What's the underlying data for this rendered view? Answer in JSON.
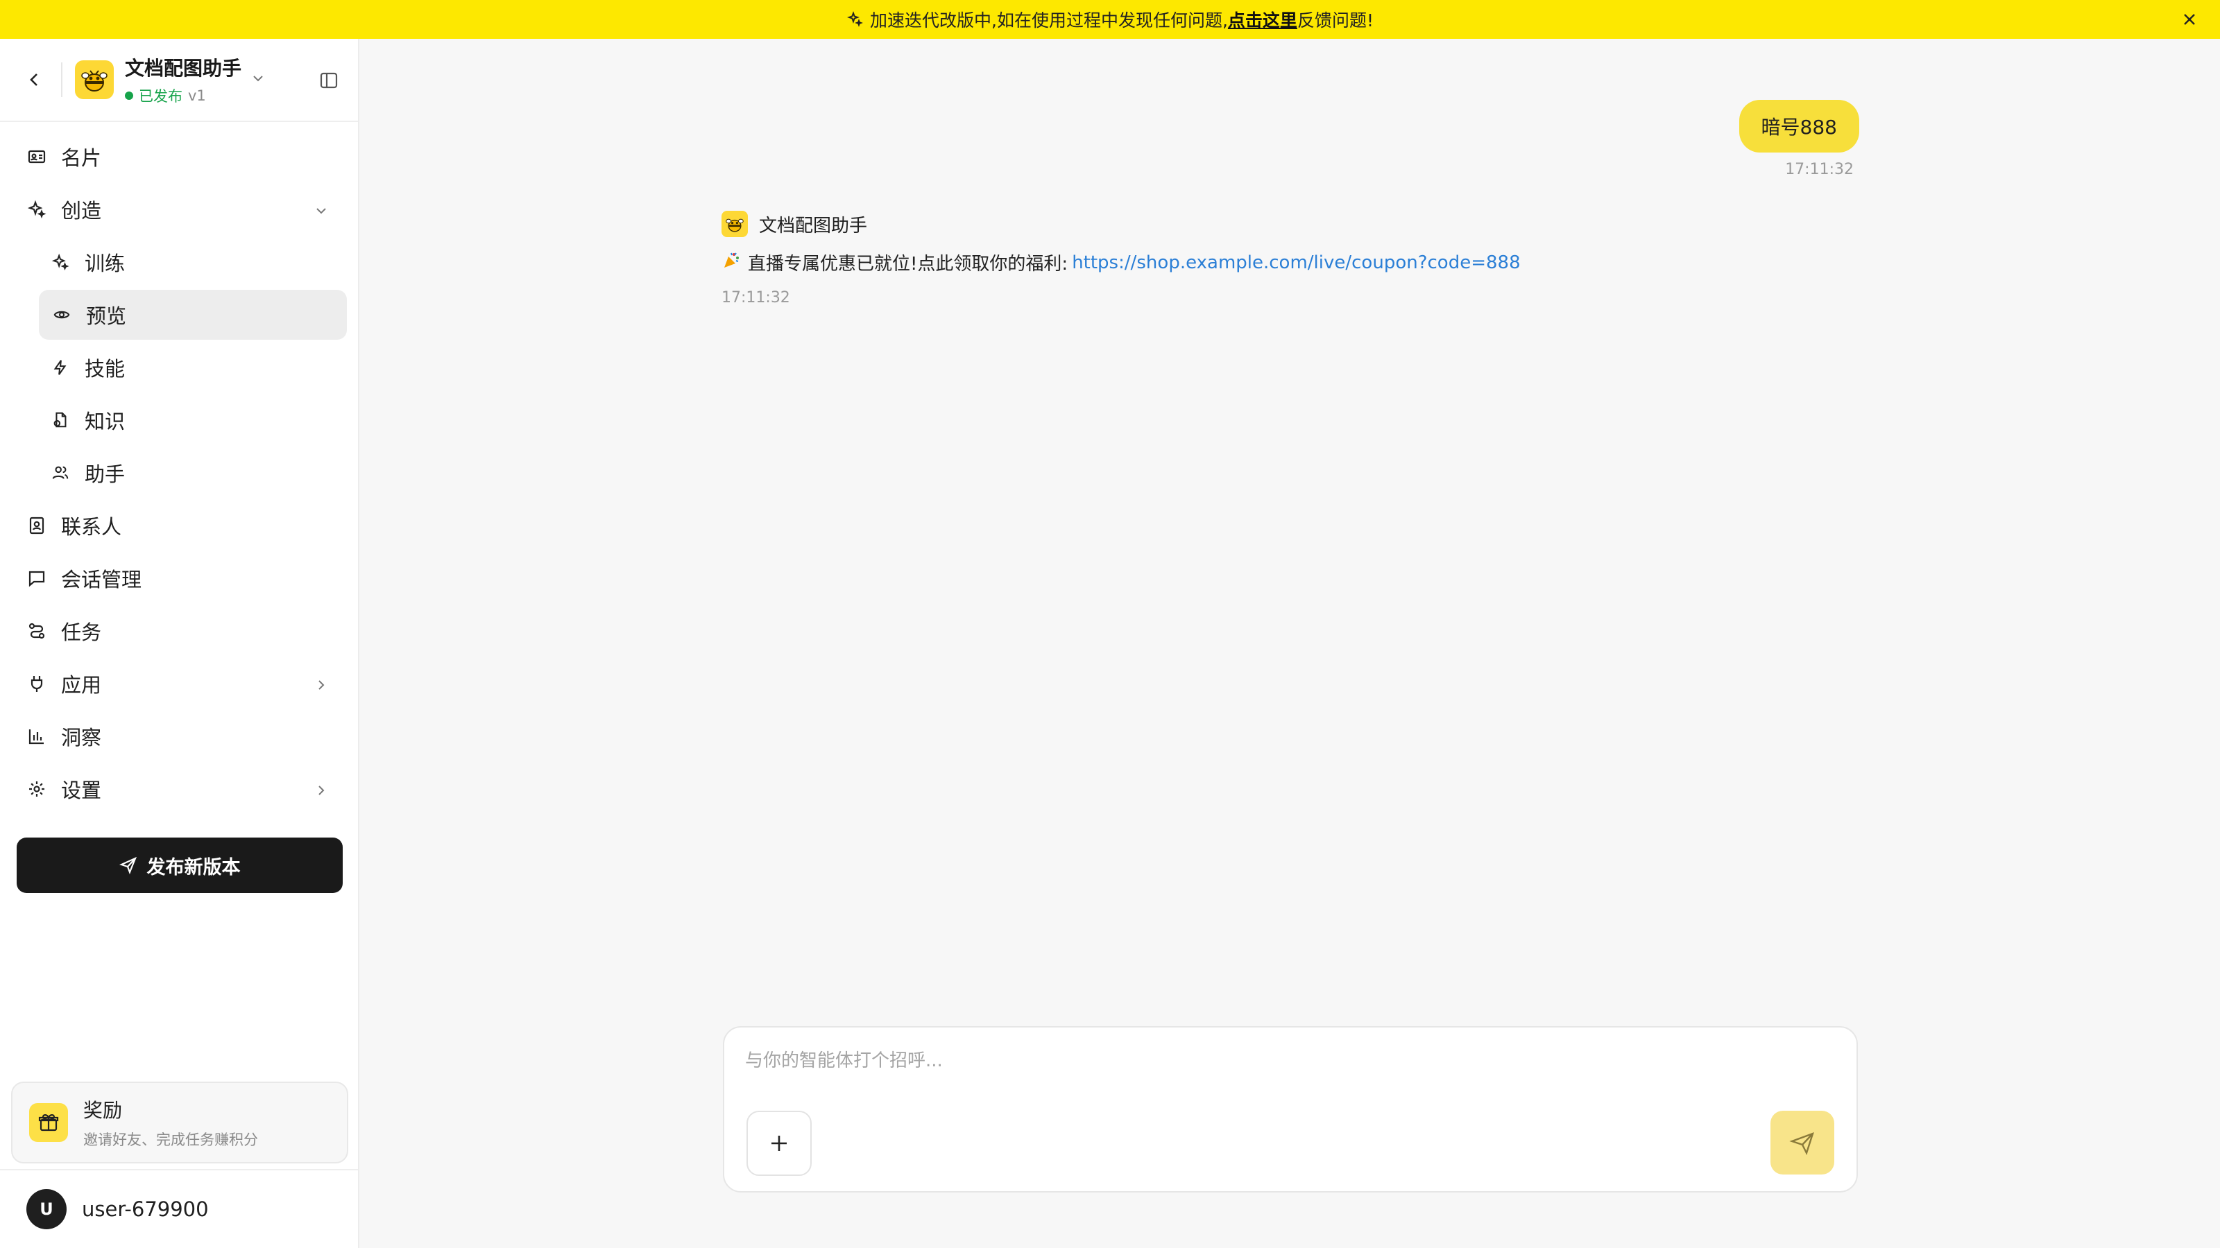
{
  "banner": {
    "text_before": "加速迭代改版中,如在使用过程中发现任何问题,",
    "link_text": "点击这里",
    "text_after": "反馈问题!",
    "color": "#fde800"
  },
  "sidebar": {
    "bot_name": "文档配图助手",
    "status": "已发布",
    "version": "v1",
    "nav": {
      "card": "名片",
      "create": "创造",
      "train": "训练",
      "preview": "预览",
      "skills": "技能",
      "knowledge": "知识",
      "assistant": "助手",
      "contacts": "联系人",
      "sessions": "会话管理",
      "tasks": "任务",
      "apps": "应用",
      "insights": "洞察",
      "settings": "设置"
    },
    "publish_label": "发布新版本",
    "reward": {
      "title": "奖励",
      "subtitle": "邀请好友、完成任务赚积分"
    },
    "user": {
      "initial": "U",
      "name": "user-679900"
    }
  },
  "chat": {
    "user_message": "暗号888",
    "user_time": "17:11:32",
    "bot_name": "文档配图助手",
    "bot_text": "直播专属优惠已就位!点此领取你的福利:",
    "bot_link": "https://shop.example.com/live/coupon?code=888",
    "bot_time": "17:11:32"
  },
  "composer": {
    "placeholder": "与你的智能体打个招呼..."
  },
  "colors": {
    "accent": "#f7df3b",
    "status_green": "#16a34a",
    "link": "#2b7fd6",
    "dark_button": "#1a1a1a"
  }
}
